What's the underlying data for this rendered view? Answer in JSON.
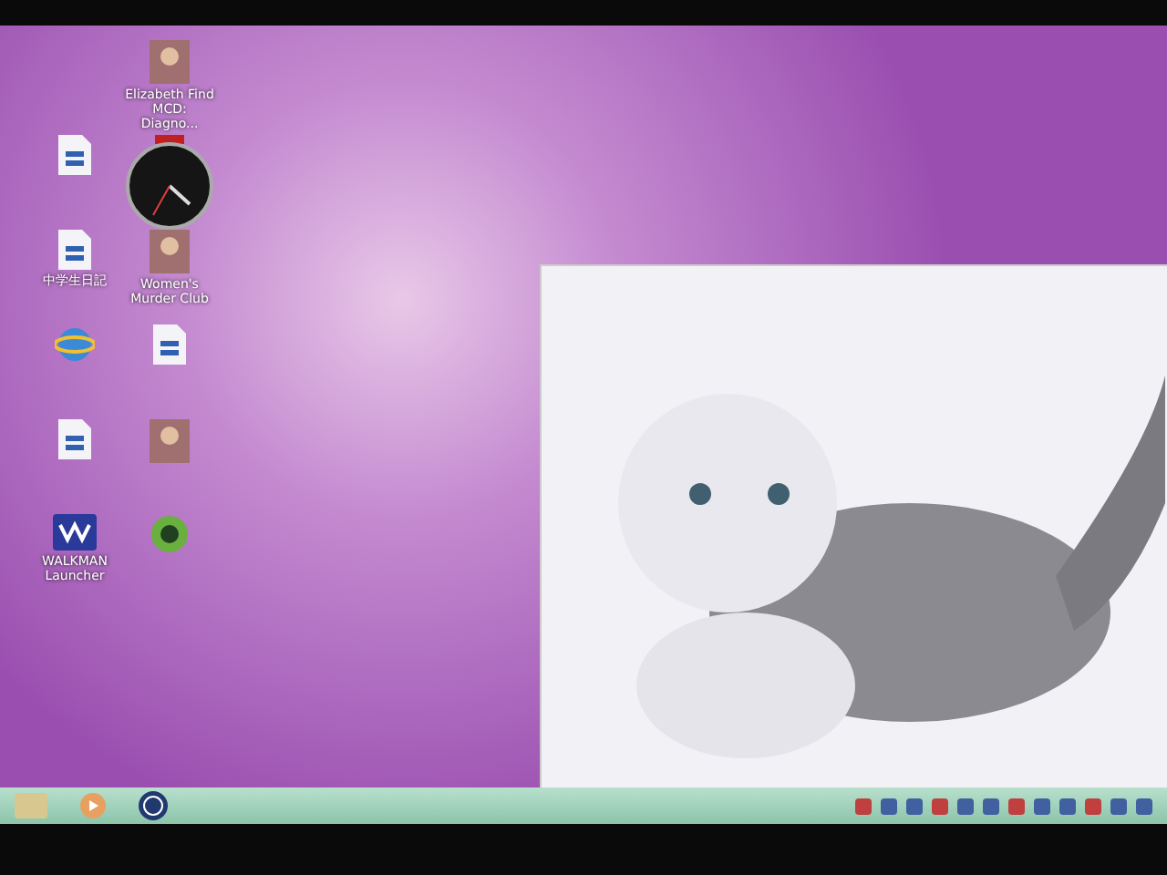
{
  "icon_columns": [
    [
      {
        "kind": "document"
      },
      {
        "kind": "document",
        "label": "中学生日記"
      },
      {
        "kind": "browser"
      },
      {
        "kind": "document"
      },
      {
        "kind": "player",
        "label": "WALKMAN Launcher"
      }
    ],
    [
      {
        "kind": "portrait",
        "label": "Elizabeth Find MCD: Diagno..."
      },
      {
        "kind": "clock"
      },
      {
        "kind": "portrait",
        "label": "Women's Murder Club"
      },
      {
        "kind": "document"
      },
      {
        "kind": "portrait"
      },
      {
        "kind": "eye"
      }
    ]
  ],
  "photo_window": {
    "kind": "kitten"
  },
  "taskbar": {
    "pinned": [
      {
        "kind": "folder"
      },
      {
        "kind": "media"
      },
      {
        "kind": "hp"
      }
    ]
  }
}
